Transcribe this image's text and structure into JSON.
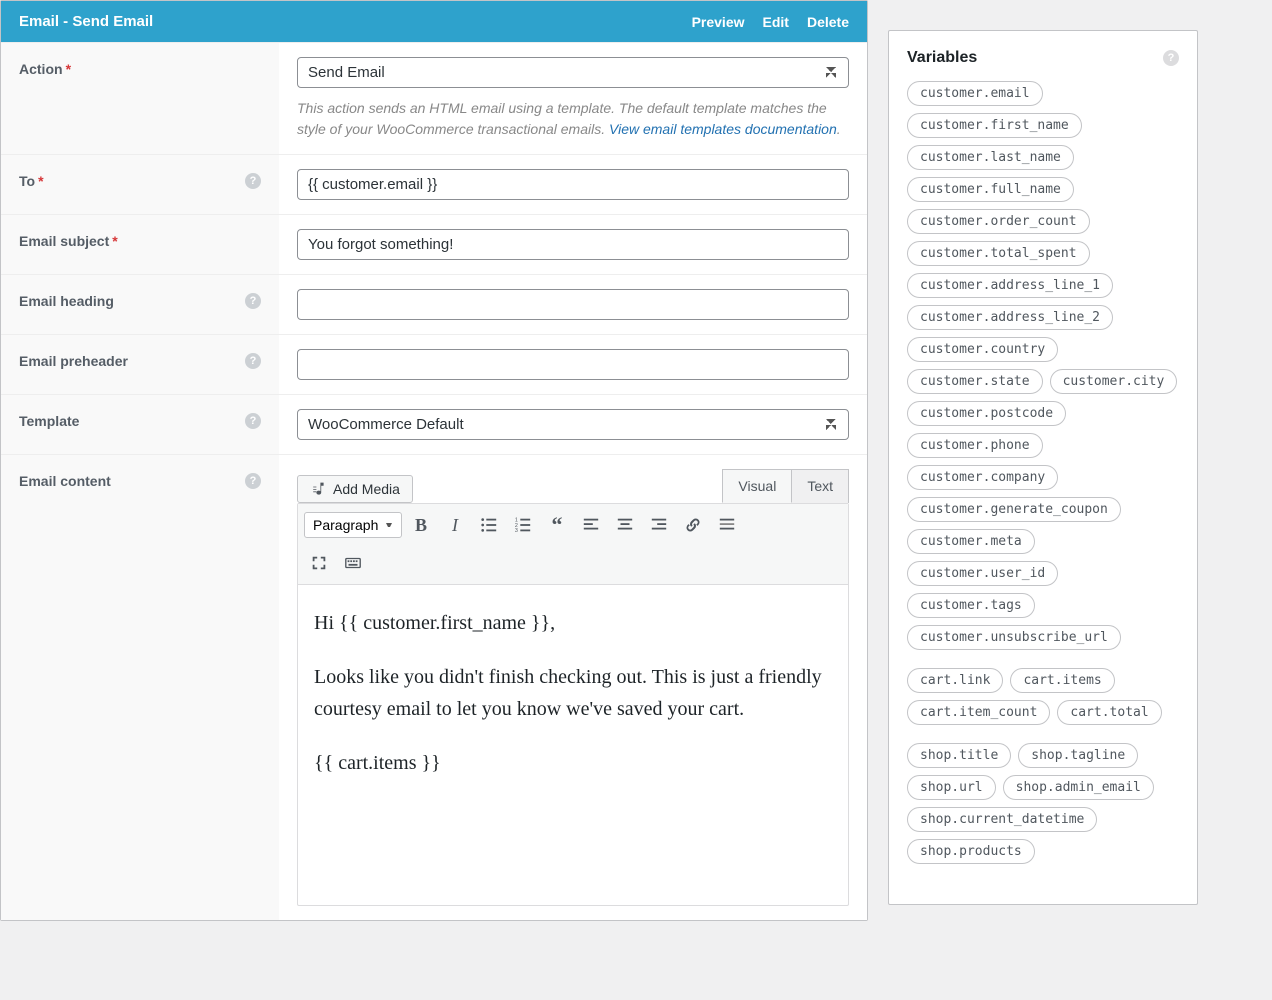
{
  "header": {
    "title": "Email - Send Email",
    "actions": {
      "preview": "Preview",
      "edit": "Edit",
      "delete": "Delete"
    }
  },
  "labels": {
    "action": "Action",
    "to": "To",
    "subject": "Email subject",
    "heading": "Email heading",
    "preheader": "Email preheader",
    "template": "Template",
    "content": "Email content"
  },
  "fields": {
    "action_select": "Send Email",
    "action_desc_pre": "This action sends an HTML email using a template. The default template matches the style of your WooCommerce transactional emails. ",
    "action_desc_link": "View email templates documentation",
    "action_desc_post": ".",
    "to_value": "{{ customer.email }}",
    "subject_value": "You forgot something!",
    "heading_value": "",
    "preheader_value": "",
    "template_select": "WooCommerce Default"
  },
  "editor": {
    "add_media": "Add Media",
    "tab_visual": "Visual",
    "tab_text": "Text",
    "format_select": "Paragraph",
    "body_p1": "Hi {{ customer.first_name }},",
    "body_p2": "Looks like you didn't finish checking out. This is just a friendly courtesy email to let you know we've saved your cart.",
    "body_p3": "{{ cart.items }}"
  },
  "sidebar": {
    "title": "Variables",
    "groups": {
      "customer": [
        "customer.email",
        "customer.first_name",
        "customer.last_name",
        "customer.full_name",
        "customer.order_count",
        "customer.total_spent",
        "customer.address_line_1",
        "customer.address_line_2",
        "customer.country",
        "customer.state",
        "customer.city",
        "customer.postcode",
        "customer.phone",
        "customer.company",
        "customer.generate_coupon",
        "customer.meta",
        "customer.user_id",
        "customer.tags",
        "customer.unsubscribe_url"
      ],
      "cart": [
        "cart.link",
        "cart.items",
        "cart.item_count",
        "cart.total"
      ],
      "shop": [
        "shop.title",
        "shop.tagline",
        "shop.url",
        "shop.admin_email",
        "shop.current_datetime",
        "shop.products"
      ]
    }
  }
}
